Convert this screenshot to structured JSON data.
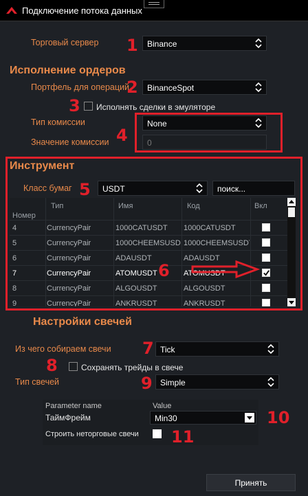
{
  "window": {
    "title": "Подключение потока данных"
  },
  "trade_server": {
    "label": "Торговый сервер",
    "value": "Binance"
  },
  "order_exec": {
    "title": "Исполнение ордеров",
    "portfolio_label": "Портфель для операций",
    "portfolio_value": "BinanceSpot",
    "emulator_label": "Исполнять сделки в эмуляторе",
    "commission_type_label": "Тип комиссии",
    "commission_type_value": "None",
    "commission_value_label": "Значение комиссии",
    "commission_value": "0"
  },
  "instrument": {
    "title": "Инструмент",
    "class_label": "Класс бумаг",
    "class_value": "USDT",
    "search_placeholder": "поиск...",
    "columns": {
      "num": "Номер",
      "type": "Тип",
      "name": "Имя",
      "code": "Код",
      "enabled": "Вкл"
    },
    "rows": [
      {
        "num": "4",
        "type": "CurrencyPair",
        "name": "1000CATUSDT",
        "code": "1000CATUSDT",
        "checked": false
      },
      {
        "num": "5",
        "type": "CurrencyPair",
        "name": "1000CHEEMSUSDT",
        "code": "1000CHEEMSUSDT",
        "checked": false
      },
      {
        "num": "6",
        "type": "CurrencyPair",
        "name": "ADAUSDT",
        "code": "ADAUSDT",
        "checked": false
      },
      {
        "num": "7",
        "type": "CurrencyPair",
        "name": "ATOMUSDT",
        "code": "ATOMUSDT",
        "checked": true
      },
      {
        "num": "8",
        "type": "CurrencyPair",
        "name": "ALGOUSDT",
        "code": "ALGOUSDT",
        "checked": false
      },
      {
        "num": "9",
        "type": "CurrencyPair",
        "name": "ANKRUSDT",
        "code": "ANKRUSDT",
        "checked": false
      }
    ]
  },
  "candles": {
    "title": "Настройки свечей",
    "source_label": "Из чего собираем свечи",
    "source_value": "Tick",
    "save_trades_label": "Сохранять трейды в свече",
    "type_label": "Тип свечей",
    "type_value": "Simple",
    "param_col_name": "Parameter name",
    "param_col_value": "Value",
    "timeframe_label": "ТаймФрейм",
    "timeframe_value": "Min30",
    "nontrading_label": "Строить неторговые свечи"
  },
  "apply_label": "Принять",
  "markers": [
    "1",
    "2",
    "3",
    "4",
    "5",
    "6",
    "7",
    "8",
    "9",
    "10",
    "11"
  ],
  "colors": {
    "accent_orange": "#e8894a",
    "annotation_red": "#e0202a",
    "background": "#1e2126"
  }
}
